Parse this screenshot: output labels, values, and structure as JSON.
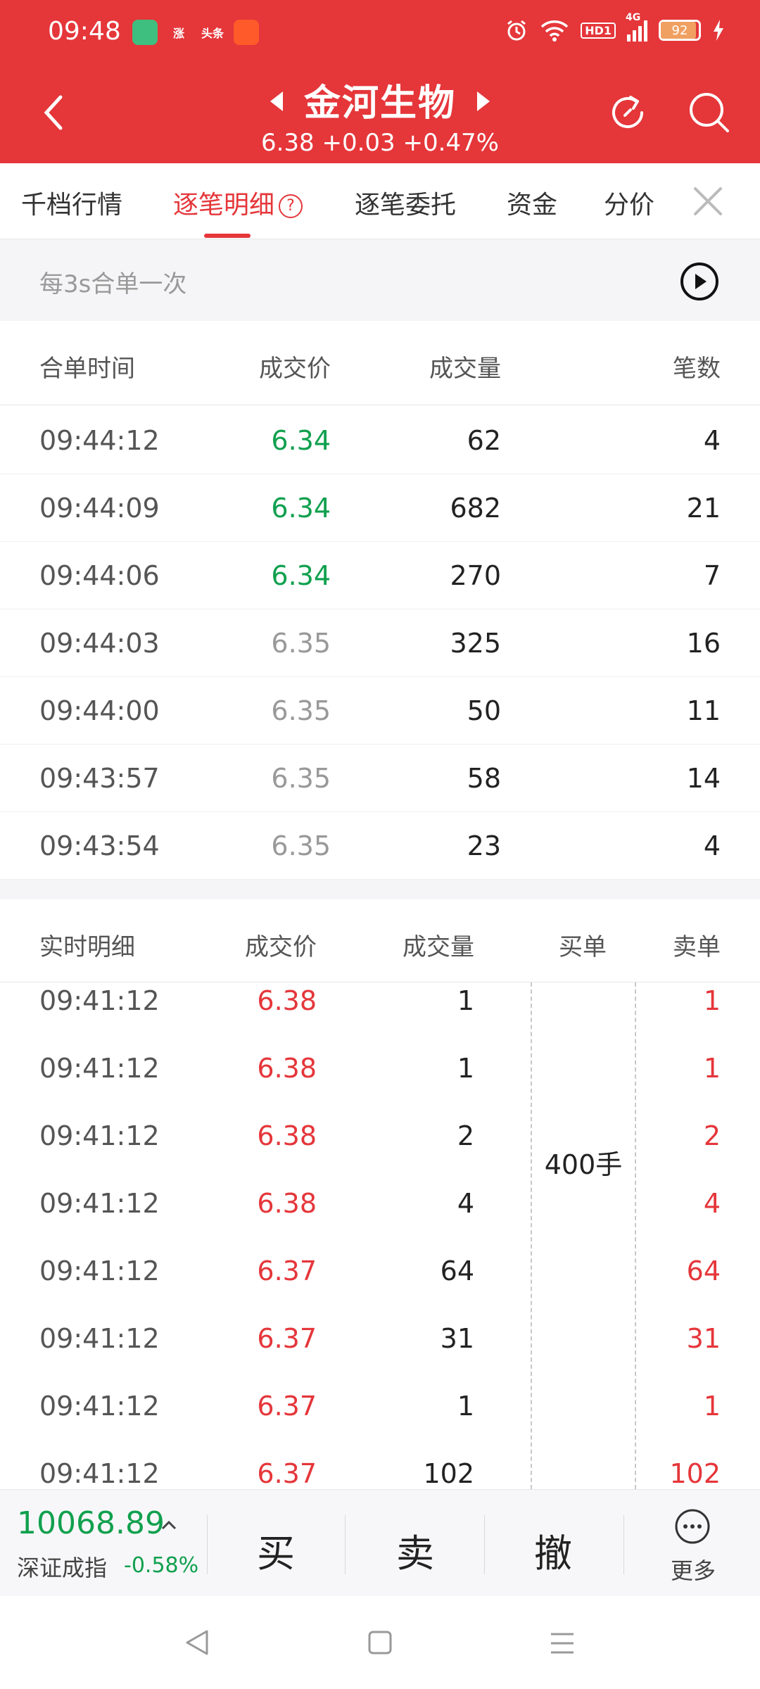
{
  "status_bar": {
    "time": "09:48",
    "battery": "92",
    "hd": "HD1",
    "network": "4G",
    "app_icons": [
      {
        "name": "phone-app-icon",
        "text": "",
        "color": "#3fbf7f"
      },
      {
        "name": "zhang-app-icon",
        "text": "涨",
        "color": "#e5363a"
      },
      {
        "name": "toutiao-app-icon",
        "text": "头条",
        "color": "#e5363a"
      },
      {
        "name": "paper-plane-app-icon",
        "text": "",
        "color": "#ff5a2a"
      }
    ]
  },
  "header": {
    "title": "金河生物",
    "subtitle": "6.38 +0.03 +0.47%"
  },
  "tabs": [
    {
      "label": "千档行情",
      "active": false
    },
    {
      "label": "逐笔明细",
      "active": true
    },
    {
      "label": "逐笔委托",
      "active": false
    },
    {
      "label": "资金",
      "active": false
    },
    {
      "label": "分价",
      "active": false
    }
  ],
  "merge_info": "每3s合单一次",
  "merged_table": {
    "headers": [
      "合单时间",
      "成交价",
      "成交量",
      "笔数"
    ],
    "rows": [
      {
        "time": "09:44:12",
        "price": "6.34",
        "volume": "62",
        "count": "4",
        "color": "green"
      },
      {
        "time": "09:44:09",
        "price": "6.34",
        "volume": "682",
        "count": "21",
        "color": "green"
      },
      {
        "time": "09:44:06",
        "price": "6.34",
        "volume": "270",
        "count": "7",
        "color": "green"
      },
      {
        "time": "09:44:03",
        "price": "6.35",
        "volume": "325",
        "count": "16",
        "color": "gray"
      },
      {
        "time": "09:44:00",
        "price": "6.35",
        "volume": "50",
        "count": "11",
        "color": "gray"
      },
      {
        "time": "09:43:57",
        "price": "6.35",
        "volume": "58",
        "count": "14",
        "color": "gray"
      },
      {
        "time": "09:43:54",
        "price": "6.35",
        "volume": "23",
        "count": "4",
        "color": "gray"
      }
    ]
  },
  "realtime_table": {
    "headers": [
      "实时明细",
      "成交价",
      "成交量",
      "买单",
      "卖单"
    ],
    "buy_order": "400手",
    "rows": [
      {
        "time": "09:41:12",
        "price": "6.38",
        "volume": "1",
        "sell": "1"
      },
      {
        "time": "09:41:12",
        "price": "6.38",
        "volume": "1",
        "sell": "1"
      },
      {
        "time": "09:41:12",
        "price": "6.38",
        "volume": "2",
        "sell": "2"
      },
      {
        "time": "09:41:12",
        "price": "6.38",
        "volume": "4",
        "sell": "4"
      },
      {
        "time": "09:41:12",
        "price": "6.37",
        "volume": "64",
        "sell": "64"
      },
      {
        "time": "09:41:12",
        "price": "6.37",
        "volume": "31",
        "sell": "31"
      },
      {
        "time": "09:41:12",
        "price": "6.37",
        "volume": "1",
        "sell": "1"
      },
      {
        "time": "09:41:12",
        "price": "6.37",
        "volume": "102",
        "sell": "102"
      }
    ]
  },
  "bottom_bar": {
    "index_value": "10068.89",
    "index_name": "深证成指",
    "index_change": "-0.58%",
    "buy": "买",
    "sell": "卖",
    "cancel": "撤",
    "more": "更多"
  },
  "colors": {
    "brand_red": "#e5363a",
    "down_green": "#10a04e",
    "neutral_gray": "#999999"
  }
}
